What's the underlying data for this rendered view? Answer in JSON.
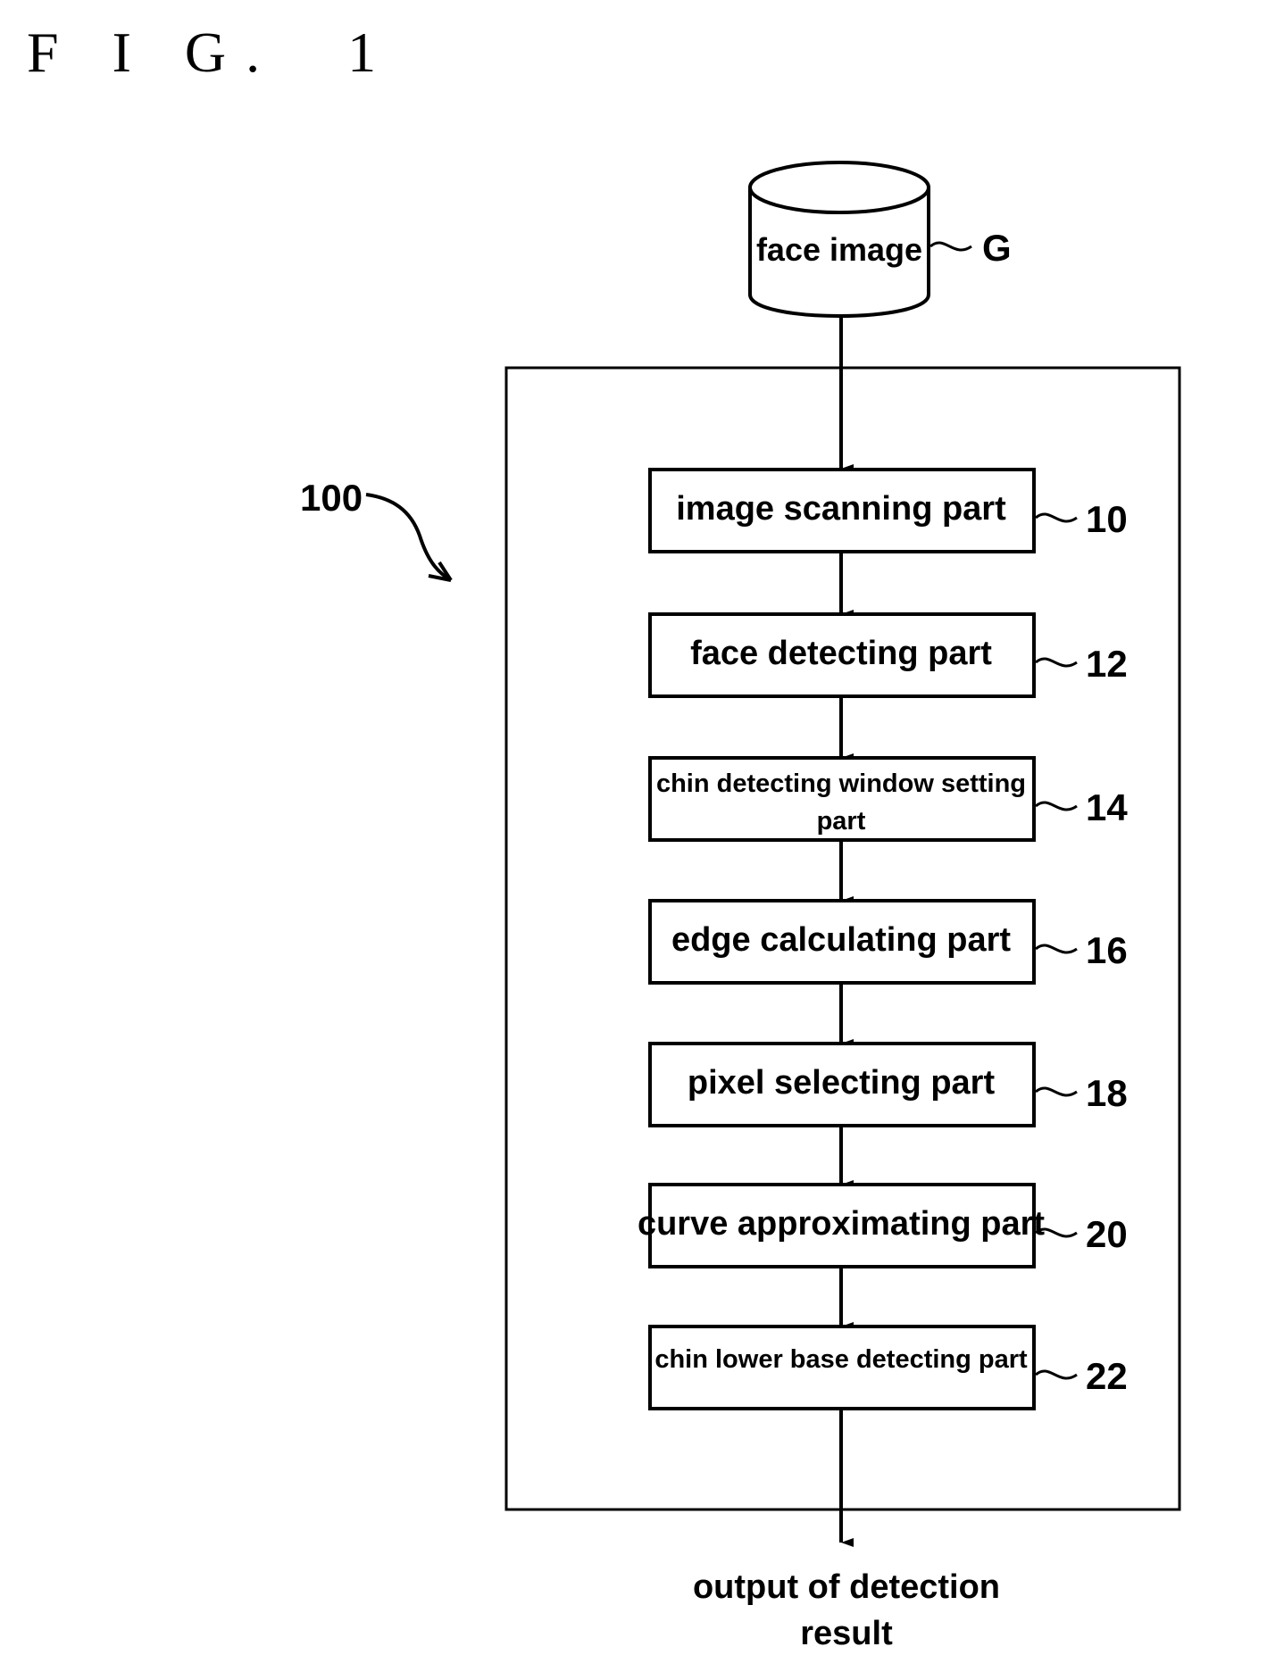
{
  "figure": {
    "title": "F I G.  1"
  },
  "database": {
    "label": "face image",
    "ref": "G"
  },
  "system": {
    "ref": "100"
  },
  "blocks": [
    {
      "label_lines": [
        "image scanning part"
      ],
      "ref": "10"
    },
    {
      "label_lines": [
        "face detecting part"
      ],
      "ref": "12"
    },
    {
      "label_lines": [
        "chin detecting window setting",
        "part"
      ],
      "ref": "14"
    },
    {
      "label_lines": [
        "edge calculating part"
      ],
      "ref": "16"
    },
    {
      "label_lines": [
        "pixel selecting part"
      ],
      "ref": "18"
    },
    {
      "label_lines": [
        "curve approximating part"
      ],
      "ref": "20"
    },
    {
      "label_lines": [
        "chin lower base detecting part"
      ],
      "ref": "22"
    }
  ],
  "output": {
    "label_lines": [
      "output of detection",
      "result"
    ]
  }
}
